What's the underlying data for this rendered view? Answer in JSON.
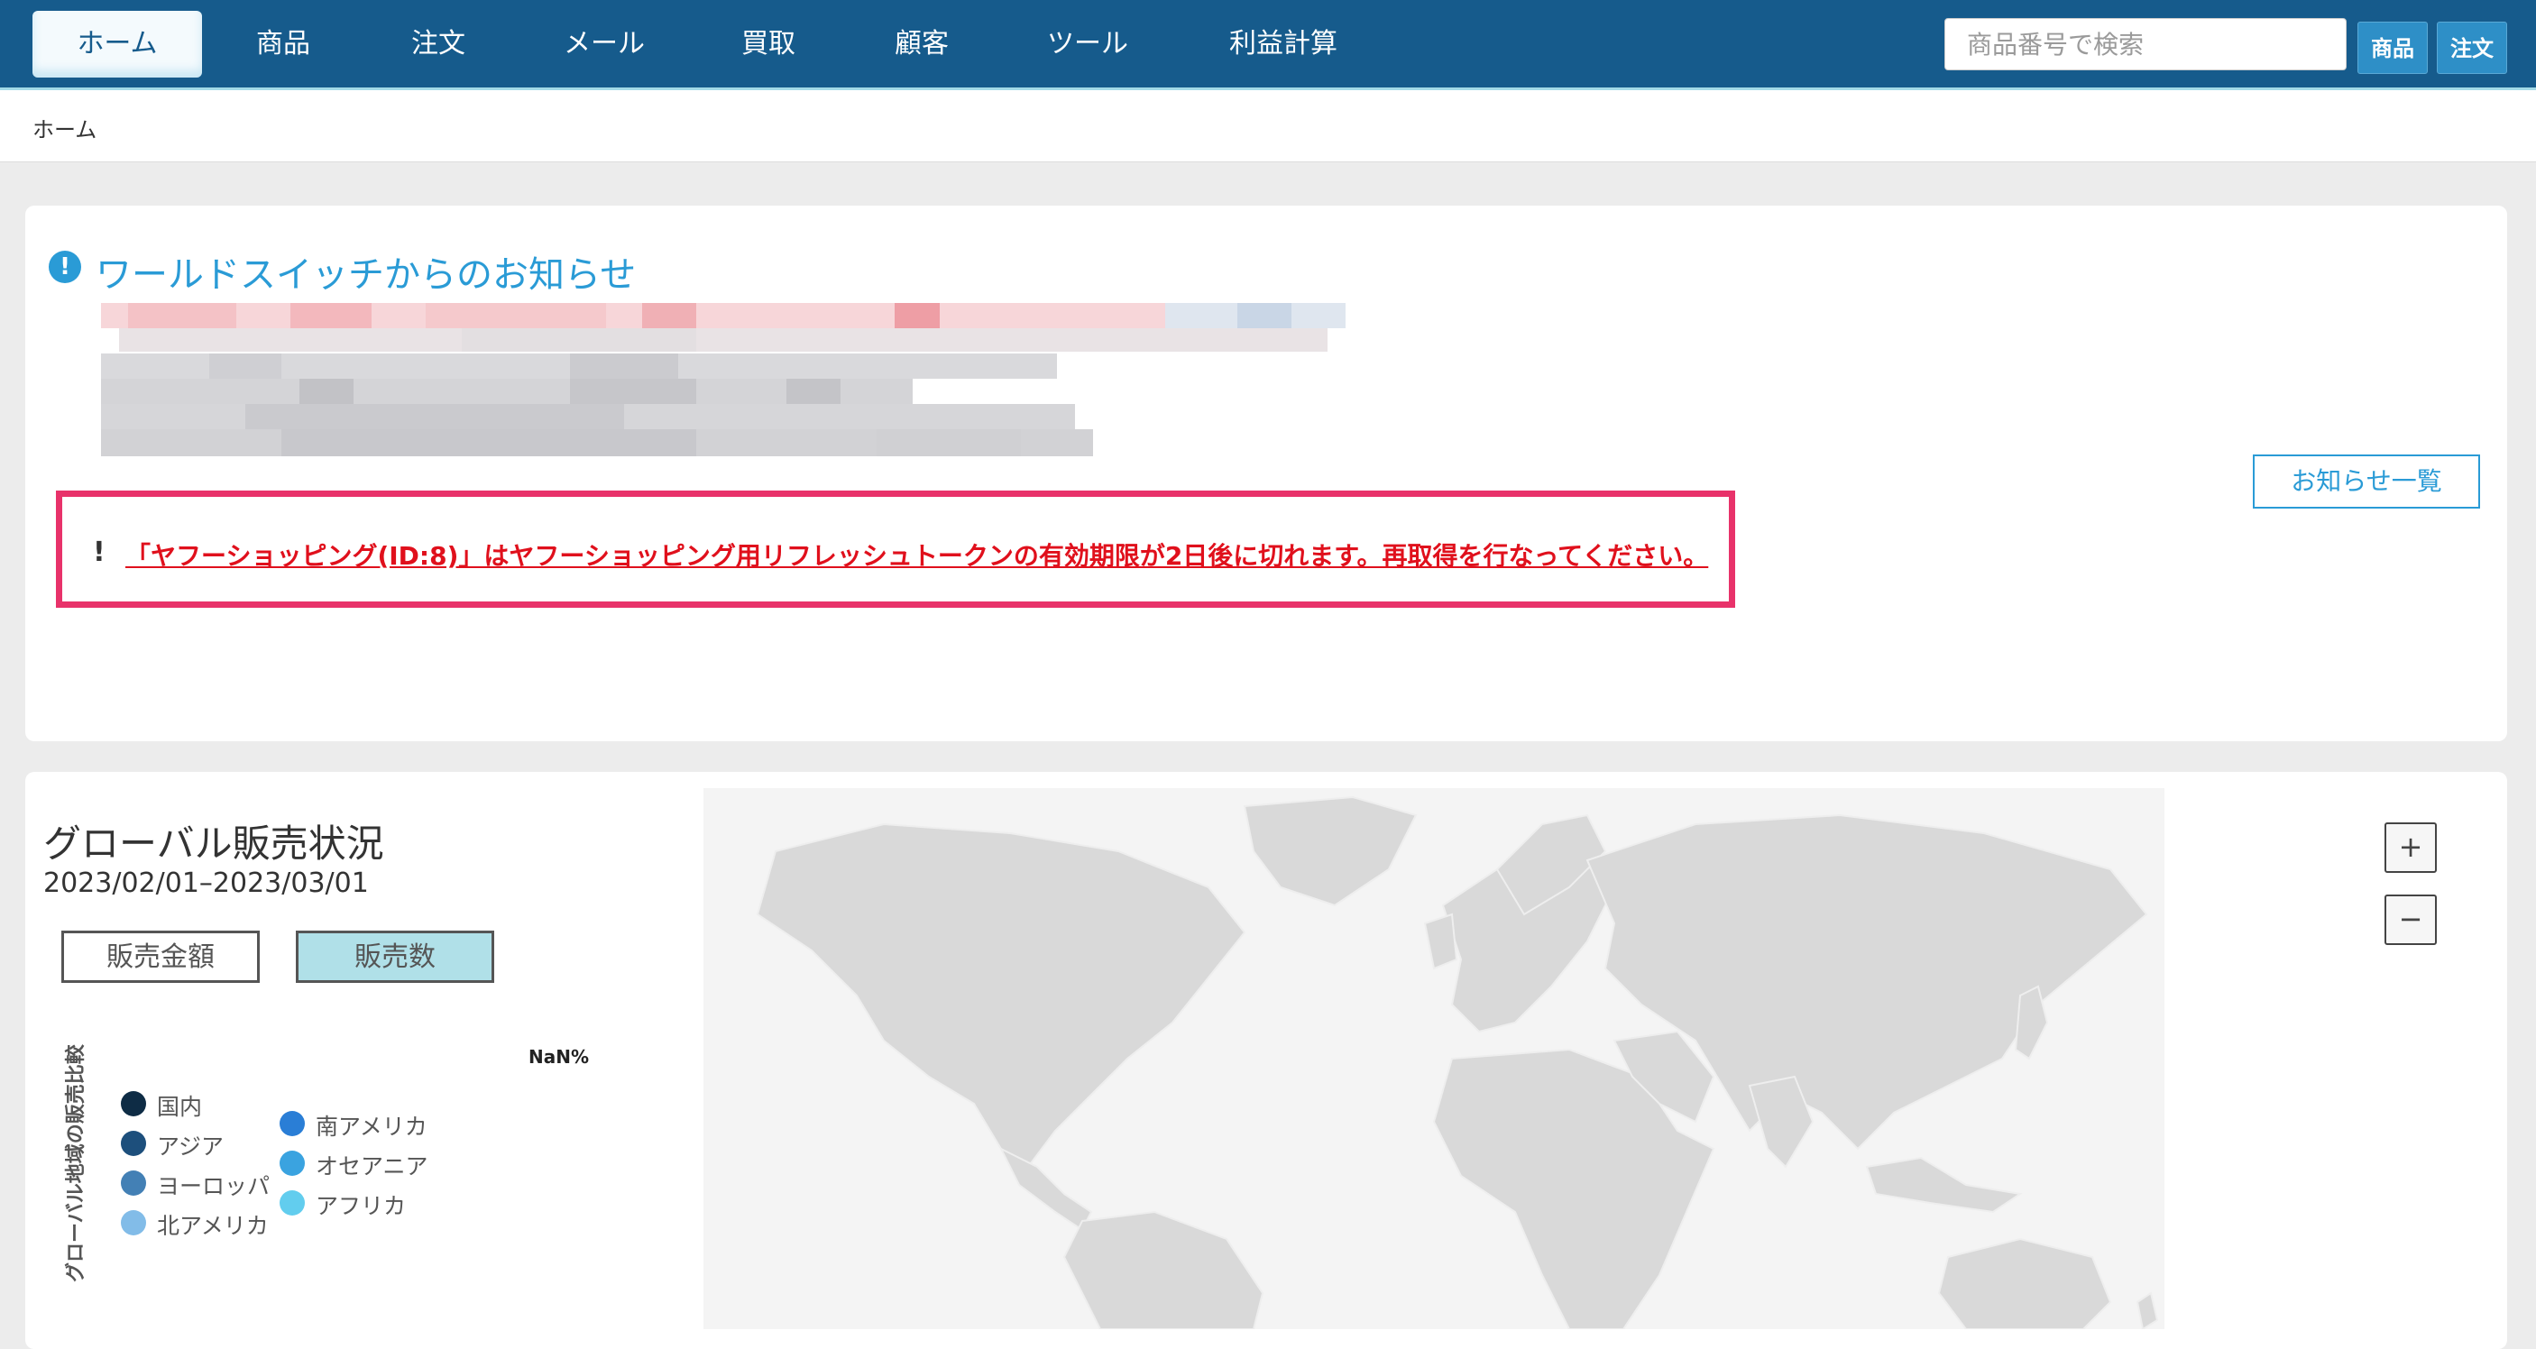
{
  "nav": {
    "items": [
      "ホーム",
      "商品",
      "注文",
      "メール",
      "買取",
      "顧客",
      "ツール",
      "利益計算"
    ],
    "search_placeholder": "商品番号で検索",
    "search_buttons": [
      "商品",
      "注文"
    ]
  },
  "breadcrumb": "ホーム",
  "notice": {
    "title": "ワールドスイッチからのお知らせ",
    "alert_mark": "!",
    "alert_text": "「ヤフーショッピング(ID:8)」はヤフーショッピング用リフレッシュトークンの有効期限が2日後に切れます。再取得を行なってください。",
    "list_button": "お知らせ一覧"
  },
  "sales": {
    "title": "グローバル販売状況",
    "date_range": "2023/02/01–2023/03/01",
    "toggle_amount": "販売金額",
    "toggle_count": "販売数",
    "chart_value": "NaN%",
    "vertical_label": "グローバル地域の販売比較",
    "legend": [
      {
        "label": "国内",
        "color": "#0e2c45"
      },
      {
        "label": "アジア",
        "color": "#1d4f7c"
      },
      {
        "label": "ヨーロッパ",
        "color": "#4380b5"
      },
      {
        "label": "北アメリカ",
        "color": "#82bce8"
      },
      {
        "label": "南アメリカ",
        "color": "#2a7ed6"
      },
      {
        "label": "オセアニア",
        "color": "#3aa3e0"
      },
      {
        "label": "アフリカ",
        "color": "#62cdee"
      }
    ],
    "zoom_in": "+",
    "zoom_out": "−"
  },
  "colors": {
    "nav_bg": "#165b8c",
    "accent": "#2a9bd6",
    "alert_border": "#e8326a",
    "alert_text": "#e0101c",
    "active_toggle": "#b0e0e8"
  }
}
